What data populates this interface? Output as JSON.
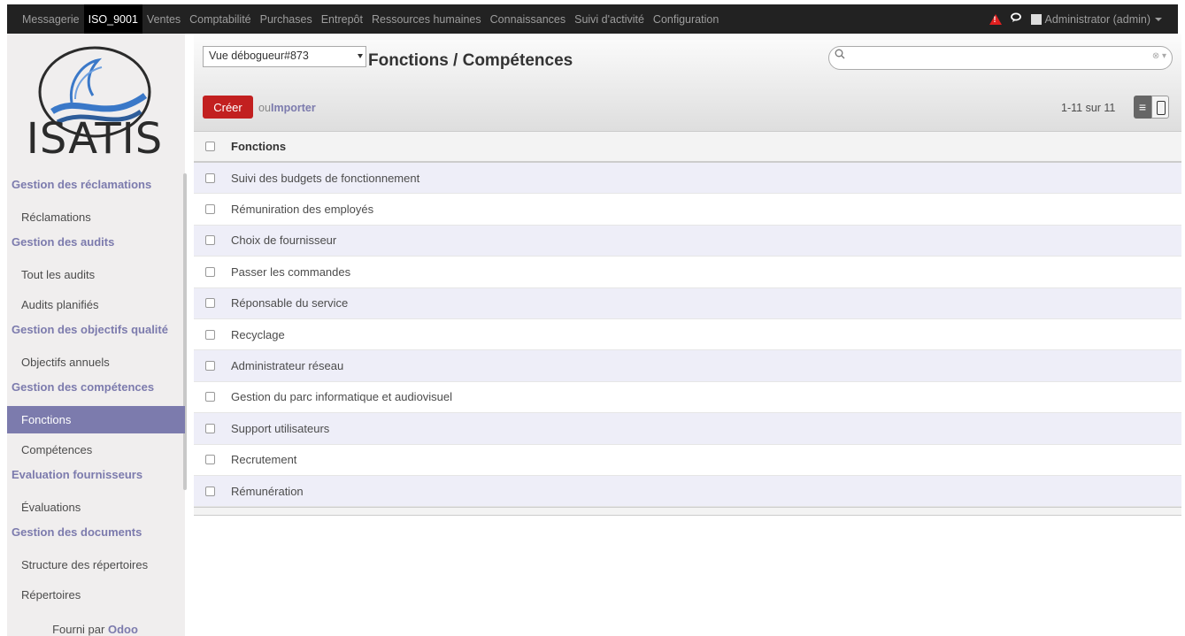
{
  "topbar": {
    "menu": [
      "Messagerie",
      "ISO_9001",
      "Ventes",
      "Comptabilité",
      "Purchases",
      "Entrepôt",
      "Ressources humaines",
      "Connaissances",
      "Suivi d'activité",
      "Configuration"
    ],
    "active": "ISO_9001",
    "user": "Administrator (admin)"
  },
  "sidebar": {
    "logo_text": "ISATIS",
    "sections": [
      {
        "title": "Gestion des réclamations",
        "items": [
          "Réclamations"
        ]
      },
      {
        "title": "Gestion des audits",
        "items": [
          "Tout les audits",
          "Audits planifiés"
        ]
      },
      {
        "title": "Gestion des objectifs qualité",
        "items": [
          "Objectifs annuels"
        ]
      },
      {
        "title": "Gestion des compétences",
        "items": [
          "Fonctions",
          "Compétences"
        ]
      },
      {
        "title": "Evaluation fournisseurs",
        "items": [
          "Évaluations"
        ]
      },
      {
        "title": "Gestion des documents",
        "items": [
          "Structure des répertoires",
          "Répertoires"
        ]
      }
    ],
    "active_item": "Fonctions",
    "footer_prefix": "Fourni par",
    "footer_brand": "Odoo"
  },
  "control_panel": {
    "debug_view": "Vue débogueur#873",
    "breadcrumb": "Fonctions / Compétences",
    "search_placeholder": "",
    "create_label": "Créer",
    "or_label": "ou",
    "import_label": "Importer",
    "pager": "1-11 sur 11"
  },
  "table": {
    "header": "Fonctions",
    "rows": [
      "Suivi des budgets de fonctionnement",
      "Rémuniration des employés",
      "Choix de fournisseur",
      "Passer les commandes",
      "Réponsable du service",
      "Recyclage",
      "Administrateur réseau",
      "Gestion du parc informatique et audiovisuel",
      "Support utilisateurs",
      "Recrutement",
      "Rémunération"
    ]
  },
  "colors": {
    "brand": "#7c7bad",
    "create": "#c22020",
    "topbar": "#222222"
  }
}
